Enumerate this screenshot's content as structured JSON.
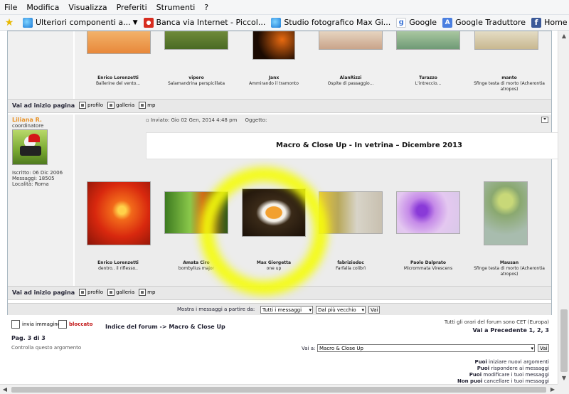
{
  "menu": [
    "File",
    "Modifica",
    "Visualizza",
    "Preferiti",
    "Strumenti",
    "?"
  ],
  "favorites": [
    {
      "label": "Ulteriori componenti a...",
      "icon": "ie-icon",
      "dropdown": true
    },
    {
      "label": "Banca via Internet - Piccol...",
      "icon": "bank-icon"
    },
    {
      "label": "Studio fotografico Max Gi...",
      "icon": "ie-icon"
    },
    {
      "label": "Google",
      "icon": "google-icon"
    },
    {
      "label": "Google Traduttore",
      "icon": "google-translate-icon"
    },
    {
      "label": "Home",
      "icon": "facebook-icon"
    }
  ],
  "top_row": {
    "images": [
      {
        "author": "Enrico Lorenzetti",
        "title": "Ballerine del vento..."
      },
      {
        "author": "vipero",
        "title": "Salamandrina perspicillata"
      },
      {
        "author": "Janx",
        "title": "Ammirando il tramonto"
      },
      {
        "author": "AlanRizzi",
        "title": "Ospite di passaggio..."
      },
      {
        "author": "Turazzo",
        "title": "L'intreccio..."
      },
      {
        "author": "manto",
        "title": "Sfinge testa di morto (Acherontia atropos)"
      }
    ]
  },
  "nav": {
    "back_top": "Vai ad inizio pagina",
    "profile": "profilo",
    "gallery": "galleria",
    "pm": "mp"
  },
  "post": {
    "user": "Liliana R.",
    "role": "coordinatore",
    "joined": "Iscritto: 06 Dic 2006",
    "messages": "Messaggi: 18505",
    "location": "Località: Roma",
    "posted": "Inviato: Gio 02 Gen, 2014 4:48 pm",
    "subject_label": "Oggetto:",
    "banner": "Macro & Close Up - In vetrina – Dicembre 2013",
    "images": [
      {
        "author": "Enrico Lorenzetti",
        "title": "dentro.. il riflesso.."
      },
      {
        "author": "Amata Ciro",
        "title": "bombylius major"
      },
      {
        "author": "Max Giorgetta",
        "title": "one up"
      },
      {
        "author": "fabriziodoc",
        "title": "Farfalla colibrì"
      },
      {
        "author": "Paolo Dalprato",
        "title": "Micrommata Virescens"
      },
      {
        "author": "Mausan",
        "title": "Sfinge testa di morto (Acherontia atropos)"
      }
    ]
  },
  "display": {
    "label": "Mostra i messaggi a partire da:",
    "range": "Tutti i messaggi",
    "order": "Dal più vecchio",
    "go": "Vai"
  },
  "footer": {
    "new_image": "invia immagine",
    "locked": "bloccato",
    "breadcrumb": "Indice del forum -> Macro & Close Up",
    "pages": "Pag. 3 di 3",
    "watch": "Controlla questo argomento",
    "timezone": "Tutti gli orari del forum sono CET (Europa)",
    "goto_prev": "Vai a Precedente  1, 2, 3",
    "goto_label": "Vai a:",
    "goto_value": "Macro & Close Up",
    "go": "Vai",
    "permissions": [
      {
        "bold": "Puoi",
        "text": " iniziare nuovi argomenti"
      },
      {
        "bold": "Puoi",
        "text": " rispondere ai messaggi"
      },
      {
        "bold": "Puoi",
        "text": " modificare i tuoi messaggi"
      },
      {
        "bold": "Non puoi",
        "text": " cancellare i tuoi messaggi"
      }
    ]
  },
  "colors": {
    "highlight": "#f4fc0c",
    "username": "#e8932a"
  }
}
